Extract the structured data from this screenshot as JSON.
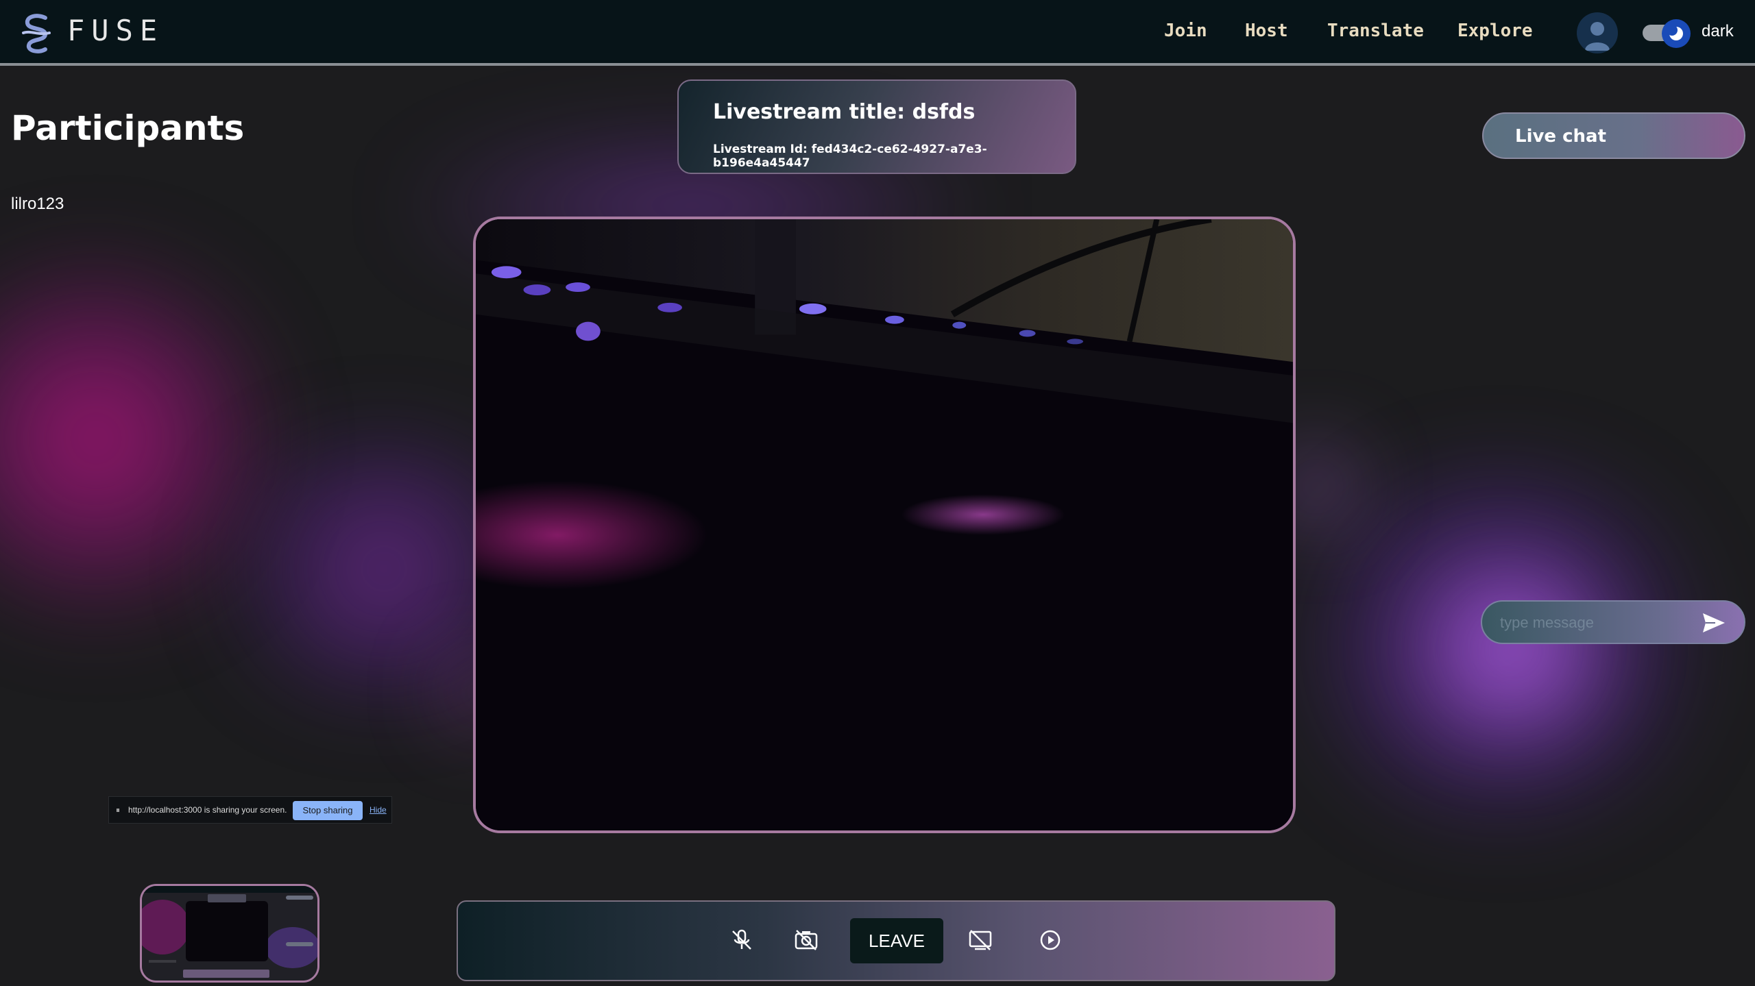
{
  "header": {
    "brand": "FUSE",
    "nav": [
      "Join",
      "Host",
      "Translate",
      "Explore"
    ],
    "theme_label": "dark"
  },
  "participants": {
    "title": "Participants",
    "list": [
      "lilro123"
    ]
  },
  "stream": {
    "title_text": "Livestream title: dsfds",
    "id_text": "Livestream Id: fed434c2-ce62-4927-a7e3-b196e4a45447"
  },
  "chat": {
    "button_label": "Live chat",
    "input_placeholder": "type message"
  },
  "screen_share": {
    "message": "http://localhost:3000 is sharing your screen.",
    "stop_label": "Stop sharing",
    "hide_label": "Hide"
  },
  "controls": {
    "leave_label": "LEAVE",
    "icons": [
      "mic-off-icon",
      "camera-off-icon",
      "screen-share-off-icon",
      "record-icon"
    ]
  },
  "colors": {
    "header_bg": "#071418",
    "page_bg": "#1c1c1e",
    "accent_purple": "#a67aa0",
    "toggle_knob": "#1a4bb8",
    "stop_sharing_btn": "#8ab4f8"
  }
}
